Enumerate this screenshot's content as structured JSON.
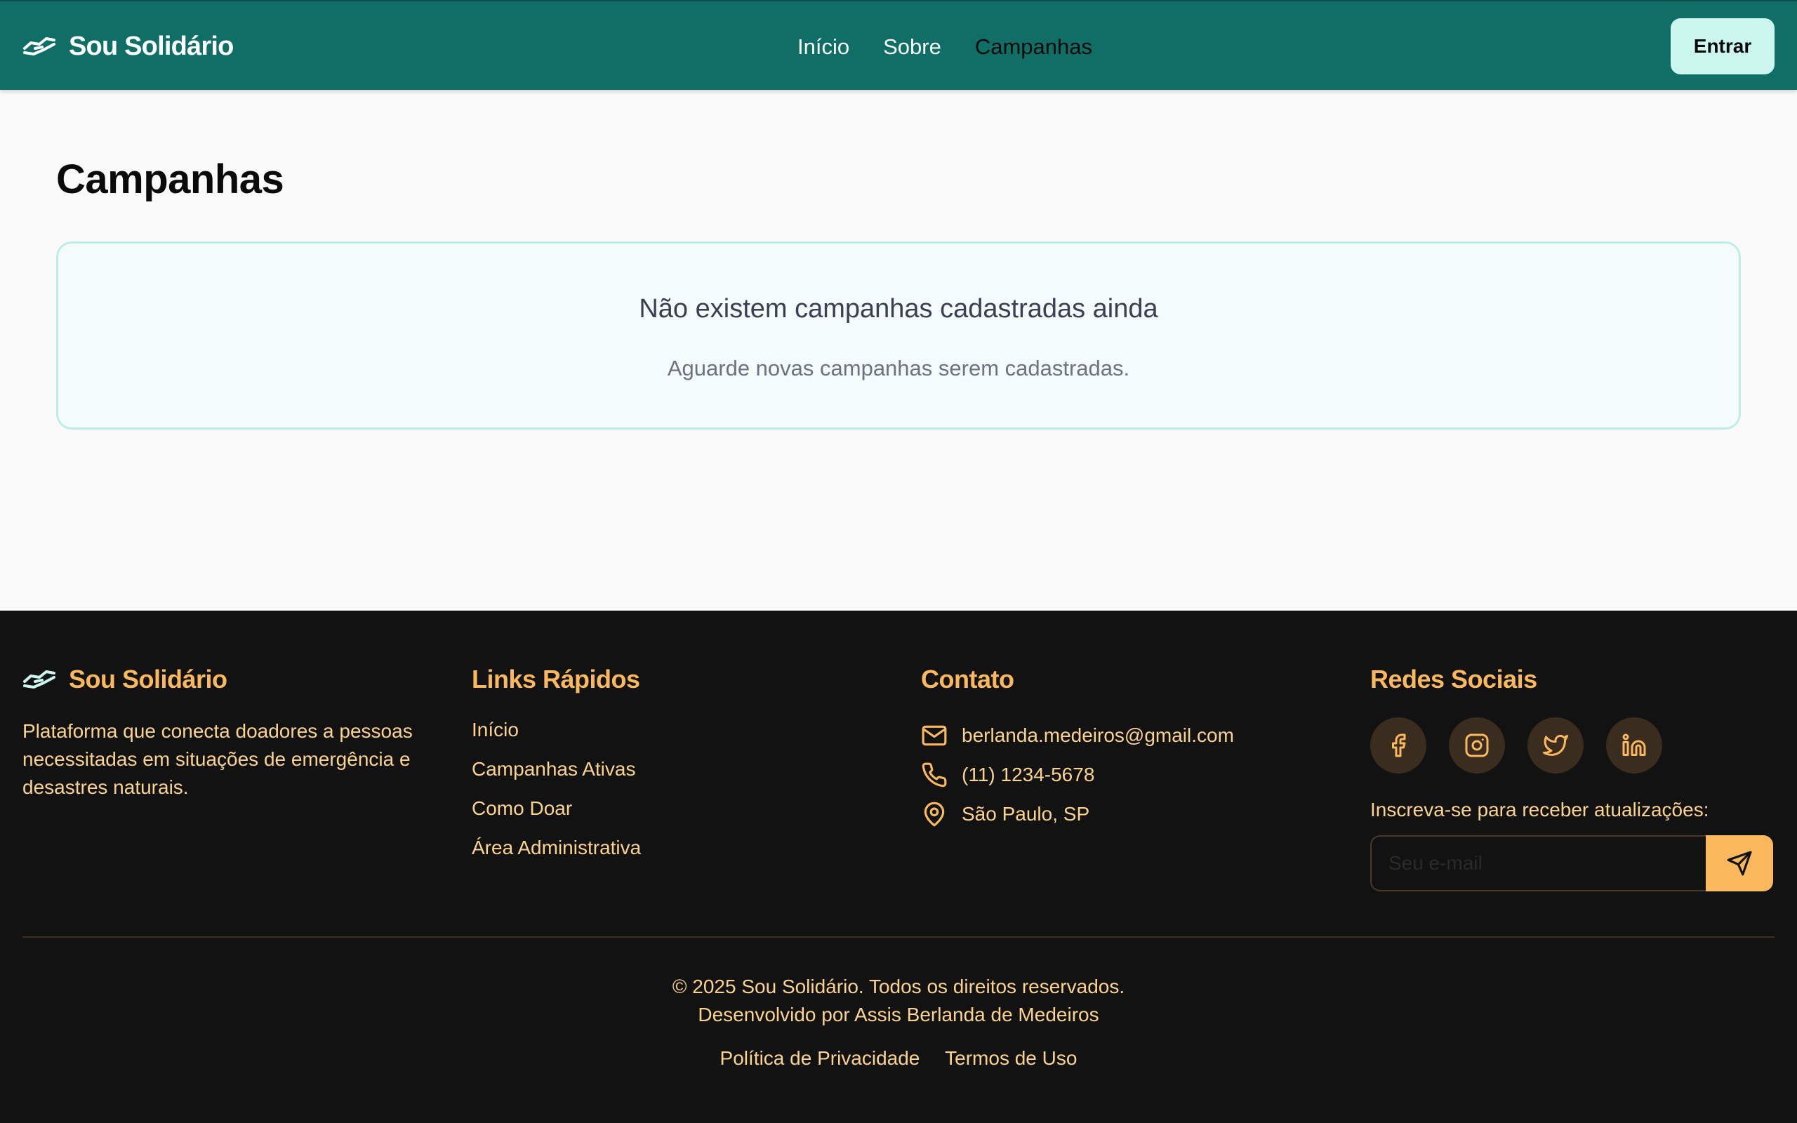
{
  "header": {
    "brand": "Sou Solidário",
    "nav": [
      {
        "label": "Início"
      },
      {
        "label": "Sobre"
      },
      {
        "label": "Campanhas"
      }
    ],
    "login_label": "Entrar"
  },
  "main": {
    "title": "Campanhas",
    "empty_title": "Não existem campanhas cadastradas ainda",
    "empty_subtitle": "Aguarde novas campanhas serem cadastradas."
  },
  "footer": {
    "brand": "Sou Solidário",
    "description": "Plataforma que conecta doadores a pessoas necessitadas em situações de emergência e desastres naturais.",
    "links_title": "Links Rápidos",
    "links": [
      "Início",
      "Campanhas Ativas",
      "Como Doar",
      "Área Administrativa"
    ],
    "contact_title": "Contato",
    "email": "berlanda.medeiros@gmail.com",
    "phone": "(11) 1234-5678",
    "location": "São Paulo, SP",
    "social_title": "Redes Sociais",
    "socials": [
      "facebook-icon",
      "instagram-icon",
      "twitter-icon",
      "linkedin-icon"
    ],
    "subscribe_label": "Inscreva-se para receber atualizações:",
    "email_placeholder": "Seu e-mail",
    "copyright": "© 2025 Sou Solidário. Todos os direitos reservados.",
    "developer": "Desenvolvido por Assis Berlanda de Medeiros",
    "privacy": "Política de Privacidade",
    "terms": "Termos de Uso"
  },
  "colors": {
    "header_bg": "#0f6e66",
    "login_bg": "#ccf7ee",
    "footer_bg": "#121212",
    "footer_accent": "#fbb85c",
    "footer_text": "#fbd38d",
    "card_border": "#bdeee6"
  }
}
